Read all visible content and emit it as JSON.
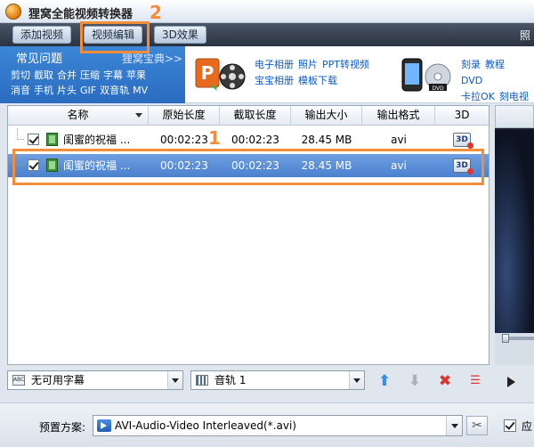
{
  "app": {
    "title": "狸窝全能视频转换器"
  },
  "toolbar": {
    "add_video": "添加视频",
    "edit_video": "视频编辑",
    "effect_3d": "3D效果",
    "right_text": "照"
  },
  "help": {
    "faq_title": "常见问题",
    "faq_more": "狸窝宝典>>",
    "faq_links": [
      "剪切",
      "截取",
      "合并",
      "压缩",
      "字幕",
      "苹果",
      "消音",
      "手机",
      "片头",
      "GIF",
      "双音轨",
      "MV"
    ],
    "promo1_links_row1": [
      "电子相册",
      "照片",
      "PPT转视频"
    ],
    "promo1_links_row2": [
      "宝宝相册",
      "模板下载"
    ],
    "promo2_links_row1": [
      "刻录",
      "教程",
      "DVD"
    ],
    "promo2_links_row2": [
      "卡拉OK",
      "刻电视"
    ]
  },
  "table": {
    "columns": [
      "名称",
      "原始长度",
      "截取长度",
      "输出大小",
      "输出格式",
      "3D"
    ],
    "rows": [
      {
        "name": "闺蜜的祝福 ...",
        "original": "00:02:23",
        "cut": "00:02:23",
        "size": "28.45 MB",
        "format": "avi",
        "selected": false,
        "checked": true
      },
      {
        "name": "闺蜜的祝福 ...",
        "original": "00:02:23",
        "cut": "00:02:23",
        "size": "28.45 MB",
        "format": "avi",
        "selected": true,
        "checked": true
      }
    ]
  },
  "annotations": {
    "step1": "1",
    "step2": "2"
  },
  "controls": {
    "subtitle": "无可用字幕",
    "audio": "音轨 1",
    "icon_sub": "ABC"
  },
  "footer": {
    "preset_label": "预置方案:",
    "preset_value": "AVI-Audio-Video Interleaved(*.avi)",
    "apply_label": "应"
  },
  "icon_3d_text": "3D",
  "colors": {
    "accent_orange": "#f28d3a",
    "selection_blue": "#4a80cf"
  }
}
